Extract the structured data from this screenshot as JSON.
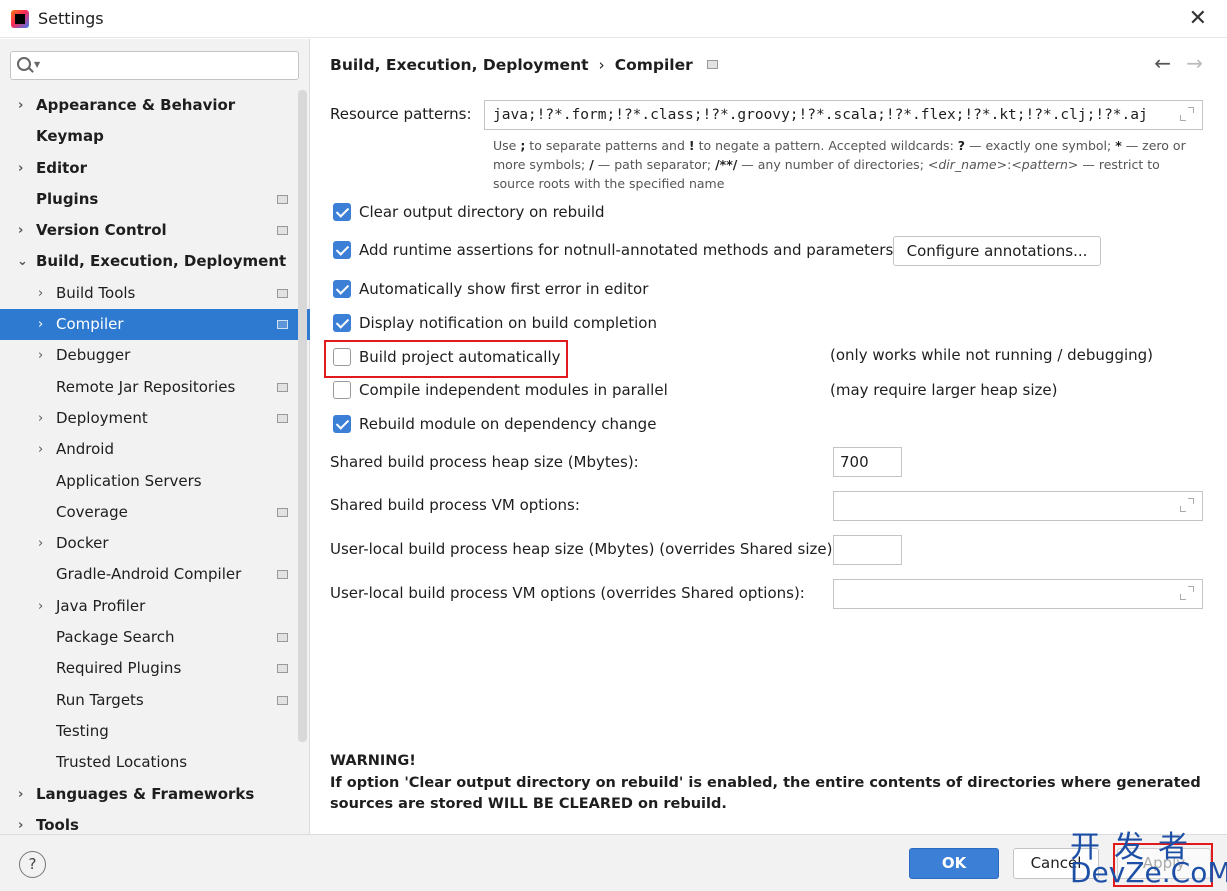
{
  "window": {
    "title": "Settings"
  },
  "search": {
    "placeholder": ""
  },
  "sidebar": {
    "items": [
      {
        "label": "Appearance & Behavior",
        "chev": "›"
      },
      {
        "label": "Keymap"
      },
      {
        "label": "Editor",
        "chev": "›"
      },
      {
        "label": "Plugins"
      },
      {
        "label": "Version Control",
        "chev": "›"
      },
      {
        "label": "Build, Execution, Deployment",
        "chev": "⌄"
      },
      {
        "label": "Build Tools",
        "chev": "›"
      },
      {
        "label": "Compiler",
        "chev": "›"
      },
      {
        "label": "Debugger",
        "chev": "›"
      },
      {
        "label": "Remote Jar Repositories"
      },
      {
        "label": "Deployment",
        "chev": "›"
      },
      {
        "label": "Android",
        "chev": "›"
      },
      {
        "label": "Application Servers"
      },
      {
        "label": "Coverage"
      },
      {
        "label": "Docker",
        "chev": "›"
      },
      {
        "label": "Gradle-Android Compiler"
      },
      {
        "label": "Java Profiler",
        "chev": "›"
      },
      {
        "label": "Package Search"
      },
      {
        "label": "Required Plugins"
      },
      {
        "label": "Run Targets"
      },
      {
        "label": "Testing"
      },
      {
        "label": "Trusted Locations"
      },
      {
        "label": "Languages & Frameworks",
        "chev": "›"
      },
      {
        "label": "Tools",
        "chev": "›"
      }
    ]
  },
  "breadcrumb": {
    "parent": "Build, Execution, Deployment",
    "sep": "›",
    "current": "Compiler"
  },
  "nav": {
    "back": "←",
    "forward": "→"
  },
  "resource": {
    "label": "Resource patterns:",
    "value": "java;!?*.form;!?*.class;!?*.groovy;!?*.scala;!?*.flex;!?*.kt;!?*.clj;!?*.aj",
    "hint": {
      "t1": "Use ",
      "b1": ";",
      "t2": " to separate patterns and ",
      "b2": "!",
      "t3": " to negate a pattern. Accepted wildcards: ",
      "b3": "?",
      "t4": " — exactly one symbol; ",
      "b4": "*",
      "t5": " — zero or more symbols; ",
      "b5": "/",
      "t6": " — path separator; ",
      "b6": "/**/",
      "t7": " — any number of directories; ",
      "i1": "<dir_name>",
      "t8": ":",
      "i2": "<pattern>",
      "t9": " — restrict to source roots with the specified name"
    }
  },
  "options": {
    "clear_output": {
      "label": "Clear output directory on rebuild",
      "checked": true
    },
    "runtime_assertions": {
      "label": "Add runtime assertions for notnull-annotated methods and parameters",
      "checked": true
    },
    "configure_annotations": "Configure annotations...",
    "show_first_error": {
      "label": "Automatically show first error in editor",
      "checked": true
    },
    "display_notification": {
      "label": "Display notification on build completion",
      "checked": true
    },
    "build_auto": {
      "label": "Build project automatically",
      "checked": false,
      "note": "(only works while not running / debugging)"
    },
    "compile_parallel": {
      "label": "Compile independent modules in parallel",
      "checked": false,
      "note": "(may require larger heap size)"
    },
    "rebuild_module": {
      "label": "Rebuild module on dependency change",
      "checked": true
    }
  },
  "heap": {
    "shared_heap_label": "Shared build process heap size (Mbytes):",
    "shared_heap_value": "700",
    "shared_vm_label": "Shared build process VM options:",
    "shared_vm_value": "",
    "user_heap_label": "User-local build process heap size (Mbytes) (overrides Shared size):",
    "user_heap_value": "",
    "user_vm_label": "User-local build process VM options (overrides Shared options):",
    "user_vm_value": ""
  },
  "warning": {
    "title": "WARNING!",
    "text": "If option 'Clear output directory on rebuild' is enabled, the entire contents of directories where generated sources are stored WILL BE CLEARED on rebuild."
  },
  "footer": {
    "help": "?",
    "ok": "OK",
    "cancel": "Cancel",
    "apply": "Apply"
  },
  "watermark": {
    "line1": "开发者",
    "line2": "DevZe.CoM"
  },
  "colors": {
    "accent": "#2f7ad1",
    "checkbox": "#3c7fd6",
    "highlight": "#e11b1b",
    "watermark": "#1d4fa6"
  }
}
